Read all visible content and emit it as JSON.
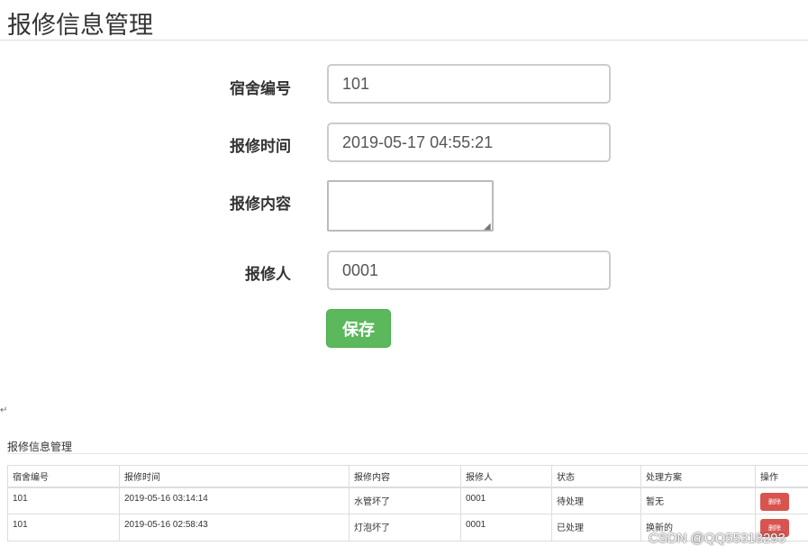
{
  "page_title": "报修信息管理",
  "form": {
    "fields": [
      {
        "label": "宿舍编号",
        "value": "101"
      },
      {
        "label": "报修时间",
        "value": "2019-05-17 04:55:21"
      },
      {
        "label": "报修内容",
        "value": ""
      },
      {
        "label": "报修人",
        "value": "0001"
      }
    ],
    "save_label": "保存"
  },
  "return_mark": "↵",
  "list": {
    "title": "报修信息管理",
    "headers": [
      "宿舍编号",
      "报修时间",
      "报修内容",
      "报修人",
      "状态",
      "处理方案",
      "操作"
    ],
    "rows": [
      {
        "room": "101",
        "time": "2019-05-16 03:14:14",
        "content": "水管坏了",
        "reporter": "0001",
        "status": "待处理",
        "solution": "暂无",
        "action": "删除"
      },
      {
        "room": "101",
        "time": "2019-05-16 02:58:43",
        "content": "灯泡坏了",
        "reporter": "0001",
        "status": "已处理",
        "solution": "换新的",
        "action": "删除"
      }
    ]
  },
  "watermark": "CSDN @QQ55318293",
  "colors": {
    "save": "#5cb85c",
    "delete": "#d9534f"
  }
}
